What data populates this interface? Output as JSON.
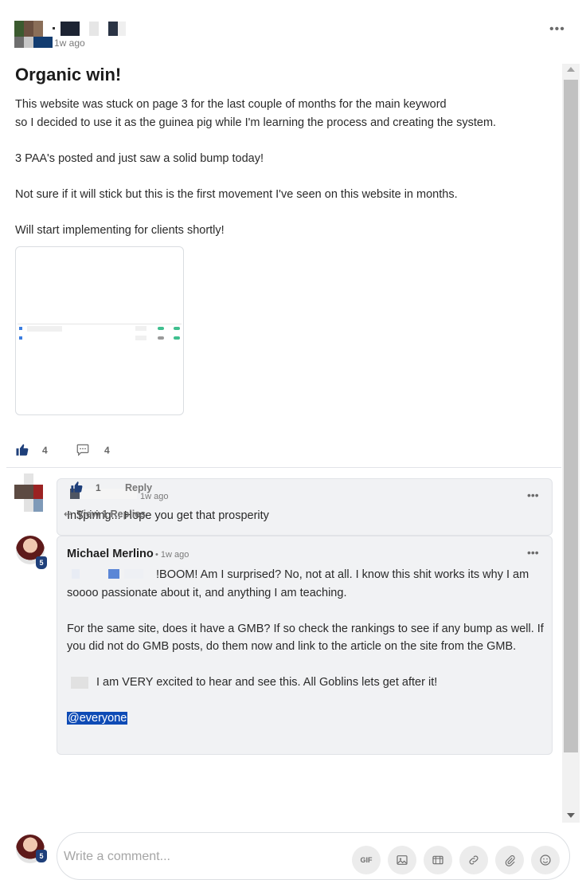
{
  "post": {
    "timestamp": "1w ago",
    "more_glyph": "•••",
    "title": "Organic win!",
    "paragraphs": [
      "This website was stuck on page 3 for the last couple of months for the main keyword\nso I decided to use it as the guinea pig while I'm learning the process and creating the system.",
      "3 PAA's posted and just saw a solid bump today!",
      "Not sure if it will stick but this is the first movement I've seen on this website in months.",
      "Will start implementing for clients shortly!"
    ],
    "like_count": "4",
    "comment_count": "4"
  },
  "comment1": {
    "timestamp": "1w ago",
    "more_glyph": "•••",
    "text": "In$piring... Hope you get that prosperity",
    "like_count": "1",
    "reply_label": "Reply",
    "view_replies_label": "View 1 Replies"
  },
  "comment2": {
    "author": "Michael Merlino",
    "timestamp": "• 1w ago",
    "more_glyph": "•••",
    "level_badge": "5",
    "line1": "!BOOM! Am I surprised? No, not at all. I know this shit works its why I am soooo passionate about it, and anything I am teaching.",
    "para2": "For the same site, does it have a GMB? If so check the rankings to see if any bump as well. If you did not do GMB posts, do them now and link to the article on the site from the GMB.",
    "para3": "I am VERY excited to hear and see this. All Goblins lets get after it!",
    "mention": "@everyone"
  },
  "composer": {
    "placeholder": "Write a comment...",
    "level_badge": "5",
    "tools": [
      {
        "name": "gif-icon",
        "label": "GIF"
      },
      {
        "name": "image-icon"
      },
      {
        "name": "video-icon"
      },
      {
        "name": "link-icon"
      },
      {
        "name": "attachment-icon"
      },
      {
        "name": "emoji-icon"
      }
    ]
  },
  "colors": {
    "accent_blue": "#0e4bb5",
    "like_blue": "#1e3f7a",
    "card_bg": "#f1f2f4"
  }
}
